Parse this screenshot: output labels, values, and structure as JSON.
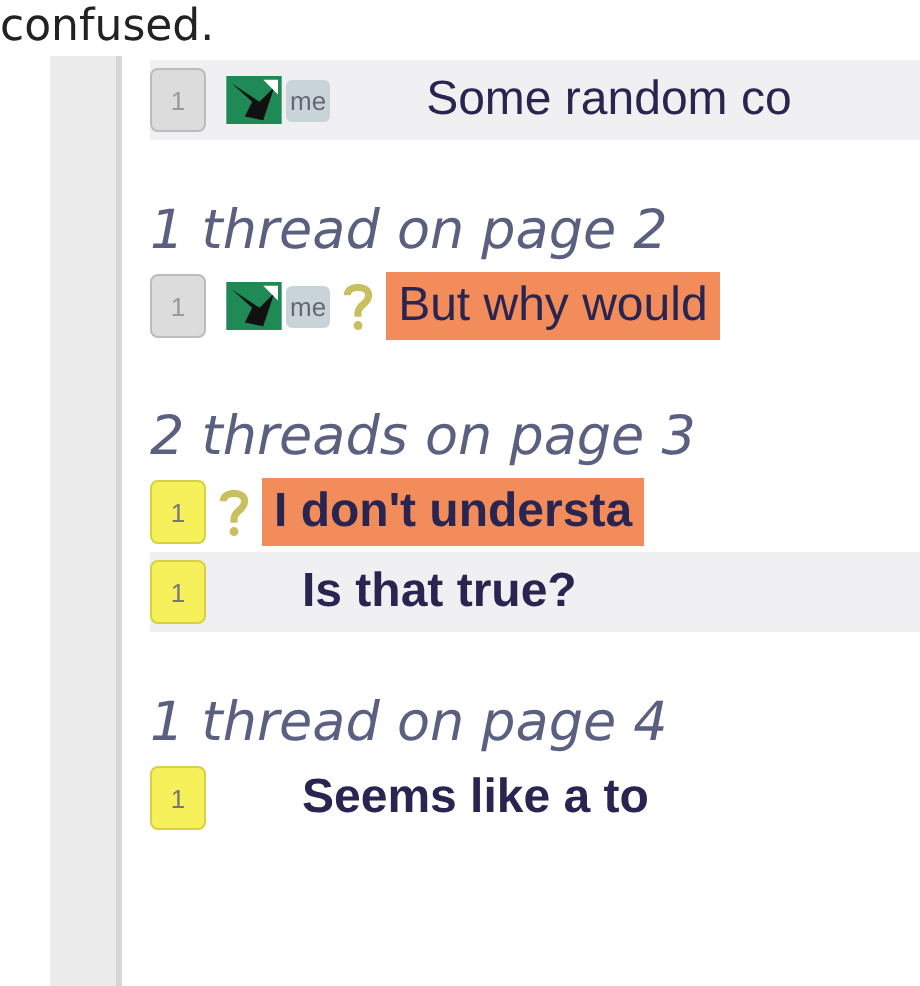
{
  "overlay_text": "confused.",
  "sections": [
    {
      "threads": [
        {
          "count": "1",
          "unread": false,
          "avatar": true,
          "tag": "me",
          "question": false,
          "highlighted": false,
          "bold": false,
          "shaded": true,
          "title": "Some random co"
        }
      ]
    },
    {
      "heading": "1 thread on page 2",
      "threads": [
        {
          "count": "1",
          "unread": false,
          "avatar": true,
          "tag": "me",
          "question": true,
          "highlighted": true,
          "bold": false,
          "shaded": false,
          "title": "But why would"
        }
      ]
    },
    {
      "heading": "2 threads on page 3",
      "threads": [
        {
          "count": "1",
          "unread": true,
          "avatar": false,
          "question": true,
          "highlighted": true,
          "bold": true,
          "shaded": false,
          "title": "I don't understa"
        },
        {
          "count": "1",
          "unread": true,
          "avatar": false,
          "question": false,
          "highlighted": false,
          "bold": true,
          "shaded": true,
          "title": "Is that true?"
        }
      ]
    },
    {
      "heading": "1 thread on page 4",
      "threads": [
        {
          "count": "1",
          "unread": true,
          "avatar": false,
          "question": false,
          "highlighted": false,
          "bold": true,
          "shaded": false,
          "title": "Seems like a to"
        }
      ]
    }
  ]
}
